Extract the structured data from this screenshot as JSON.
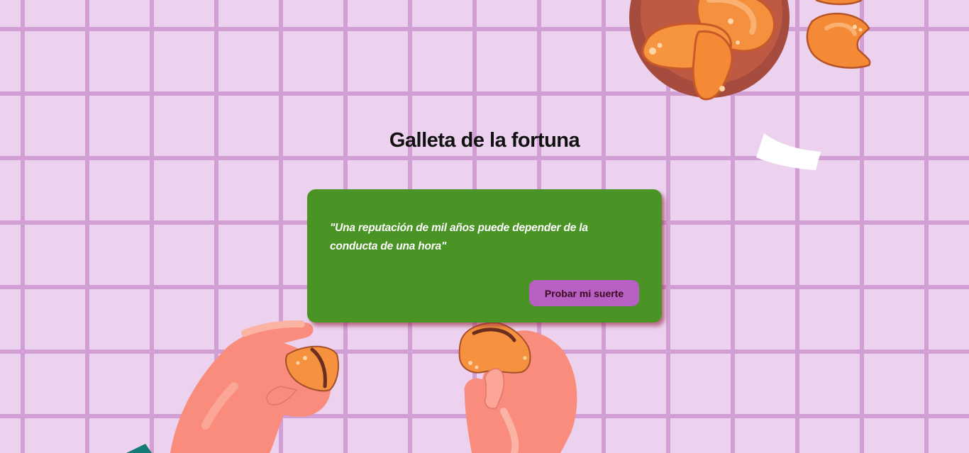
{
  "page": {
    "title": "Galleta de la fortuna"
  },
  "fortune": {
    "message": "\"Una reputación de mil años puede depender de la conducta de una hora\"",
    "button_label": "Probar mi suerte"
  },
  "colors": {
    "background": "#ecd2ef",
    "grid_lines": "#d29fd4",
    "card": "#4a9325",
    "button": "#b85fc3",
    "button_text": "#3a0a1e",
    "cookie": "#f58a3c",
    "hand": "#f98c7c"
  }
}
